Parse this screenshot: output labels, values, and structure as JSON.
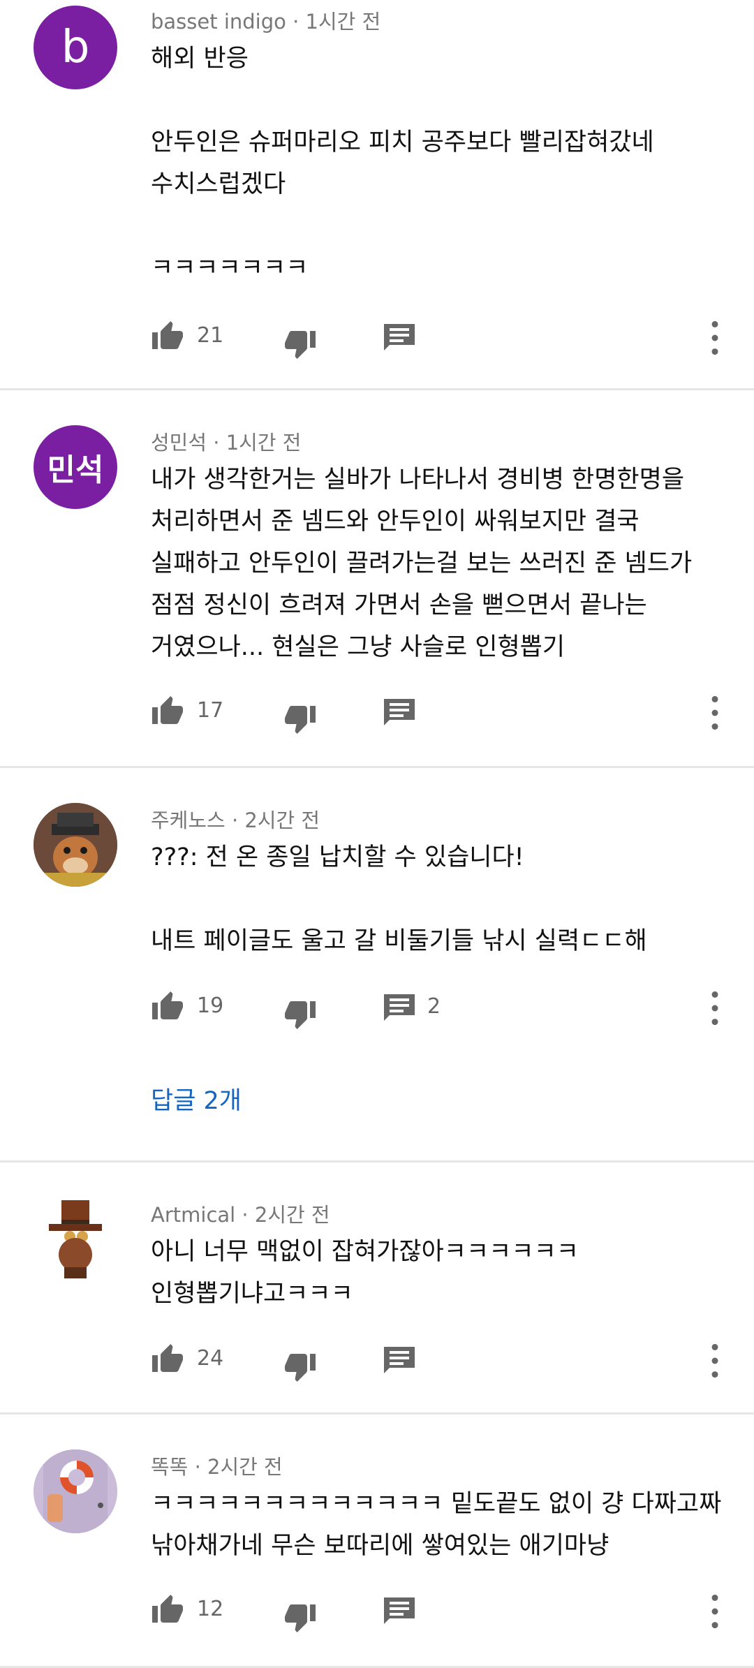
{
  "comments": [
    {
      "author": "basset indigo",
      "time": "1시간 전",
      "avatar": {
        "type": "letter",
        "text": "b",
        "color": "#7b1fa2"
      },
      "text": "해외 반응\n\n안두인은 슈퍼마리오 피치 공주보다 빨리잡혀갔네\n수치스럽겠다\n\nㅋㅋㅋㅋㅋㅋㅋ",
      "likes": "21",
      "replies_count": ""
    },
    {
      "author": "성민석",
      "time": "1시간 전",
      "avatar": {
        "type": "letter",
        "text": "민석",
        "color": "#7b1fa2"
      },
      "text": "내가 생각한거는 실바가 나타나서 경비병 한명한명을\n처리하면서 준 넴드와 안두인이 싸워보지만 결국\n실패하고 안두인이 끌려가는걸 보는 쓰러진 준 넴드가\n점점 정신이 흐려져 가면서 손을 뻗으면서 끝나는\n거였으나... 현실은 그냥 사슬로 인형뽑기",
      "likes": "17",
      "replies_count": ""
    },
    {
      "author": "주케노스",
      "time": "2시간 전",
      "avatar": {
        "type": "image",
        "icon": "fox-character-avatar"
      },
      "text": "???: 전 온 종일 납치할 수 있습니다!\n\n내트 페이글도 울고 갈 비둘기들 낚시 실력ㄷㄷ해",
      "likes": "19",
      "replies_count": "2",
      "replies_link": "답글 2개"
    },
    {
      "author": "Artmical",
      "time": "2시간 전",
      "avatar": {
        "type": "image",
        "icon": "top-hat-character-avatar"
      },
      "text": "아니 너무 맥없이 잡혀가잖아ㅋㅋㅋㅋㅋㅋ\n인형뽑기냐고ㅋㅋㅋ",
      "likes": "24",
      "replies_count": ""
    },
    {
      "author": "똑똑",
      "time": "2시간 전",
      "avatar": {
        "type": "image",
        "icon": "lifebuoy-door-avatar"
      },
      "text": "ㅋㅋㅋㅋㅋㅋㅋㅋㅋㅋㅋㅋㅋ 밑도끝도 없이 걍 다짜고짜\n낚아채가네 무슨 보따리에 쌓여있는 애기마냥",
      "likes": "12",
      "replies_count": ""
    }
  ]
}
